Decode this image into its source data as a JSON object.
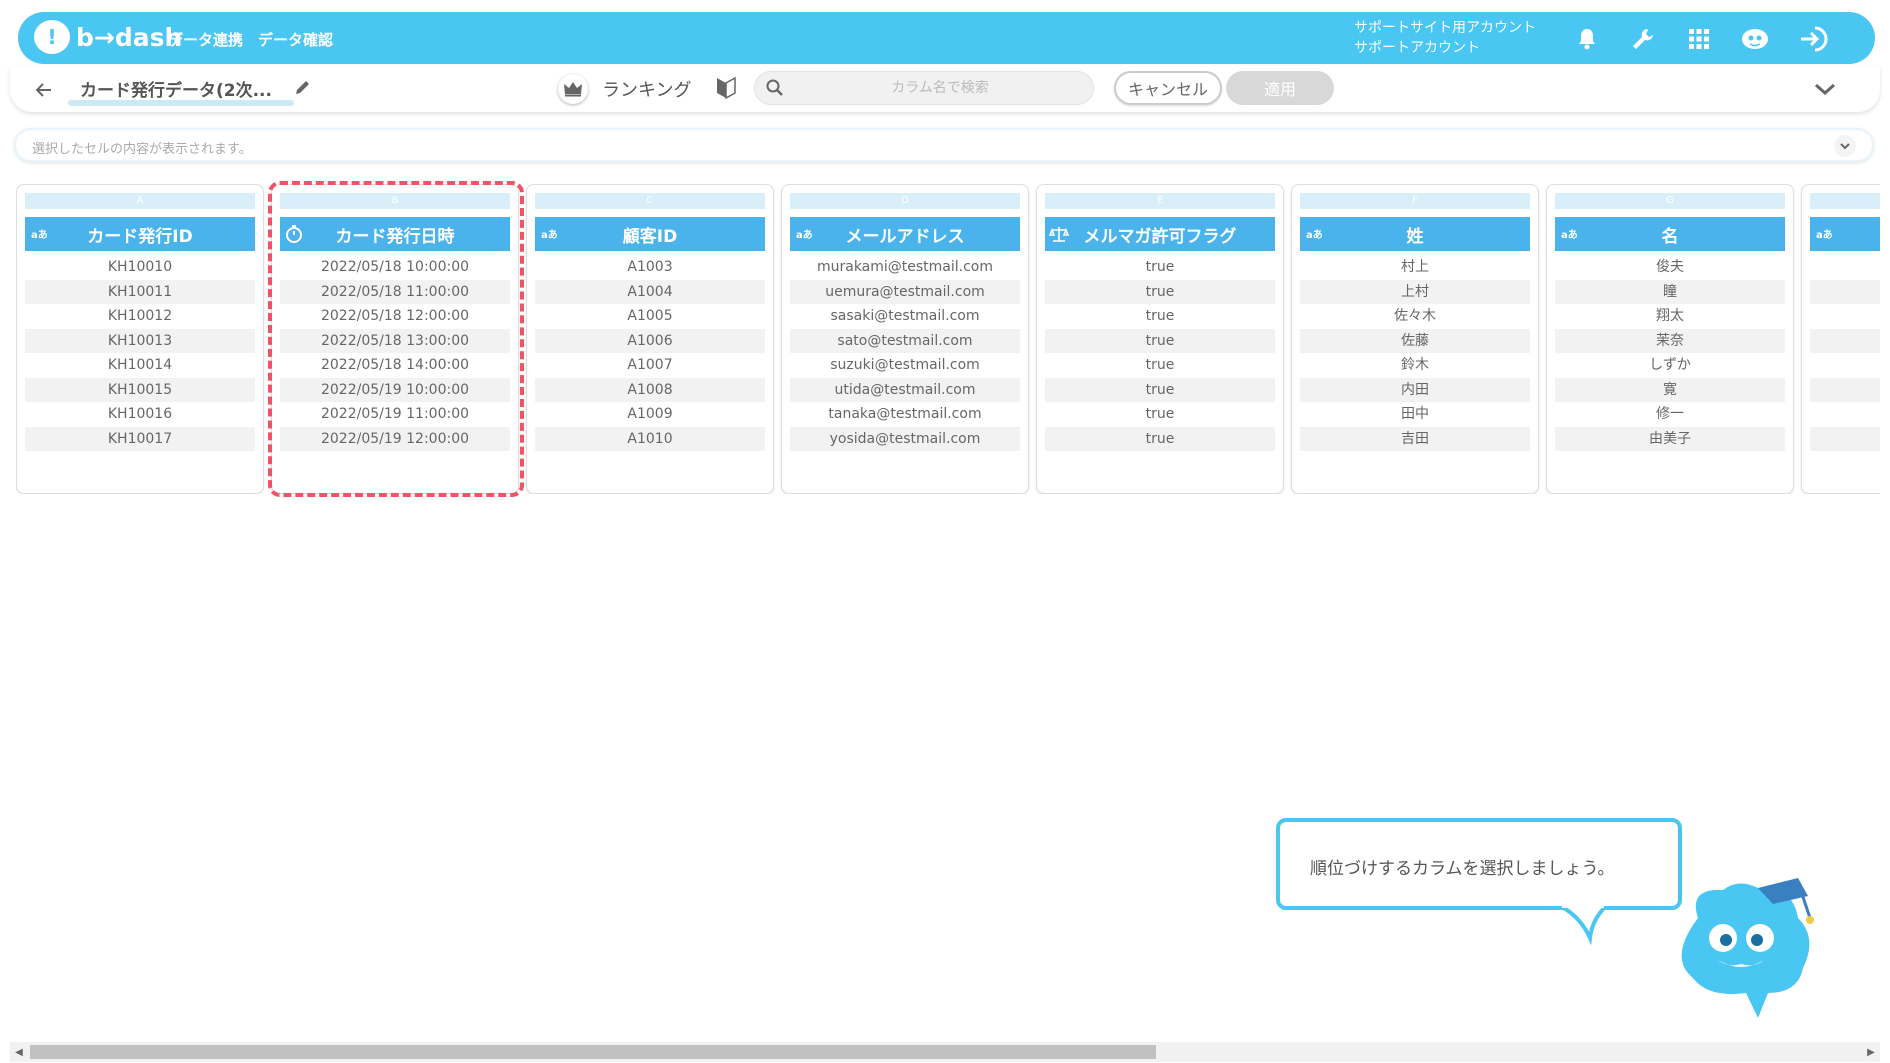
{
  "header": {
    "logo_text": "b→dash",
    "nav": [
      "データ連携",
      "データ確認"
    ],
    "account_line1": "サポートサイト用アカウント",
    "account_line2": "サポートアカウント",
    "icons": [
      "bell-icon",
      "wrench-icon",
      "apps-grid-icon",
      "robot-assistant-icon",
      "logout-icon"
    ]
  },
  "toolbar": {
    "file_title": "カード発行データ(2次...",
    "ranking_label": "ランキング",
    "search_placeholder": "カラム名で検索",
    "cancel_label": "キャンセル",
    "apply_label": "適用"
  },
  "cellbar": {
    "placeholder": "選択したセルの内容が表示されます。"
  },
  "columns": [
    {
      "letter": "A",
      "type": "aあ",
      "name": "カード発行ID",
      "values": [
        "KH10010",
        "KH10011",
        "KH10012",
        "KH10013",
        "KH10014",
        "KH10015",
        "KH10016",
        "KH10017"
      ]
    },
    {
      "letter": "B",
      "type": "timer-icon",
      "name": "カード発行日時",
      "values": [
        "2022/05/18 10:00:00",
        "2022/05/18 11:00:00",
        "2022/05/18 12:00:00",
        "2022/05/18 13:00:00",
        "2022/05/18 14:00:00",
        "2022/05/19 10:00:00",
        "2022/05/19 11:00:00",
        "2022/05/19 12:00:00"
      ]
    },
    {
      "letter": "C",
      "type": "aあ",
      "name": "顧客ID",
      "values": [
        "A1003",
        "A1004",
        "A1005",
        "A1006",
        "A1007",
        "A1008",
        "A1009",
        "A1010"
      ]
    },
    {
      "letter": "D",
      "type": "aあ",
      "name": "メールアドレス",
      "values": [
        "murakami@testmail.com",
        "uemura@testmail.com",
        "sasaki@testmail.com",
        "sato@testmail.com",
        "suzuki@testmail.com",
        "utida@testmail.com",
        "tanaka@testmail.com",
        "yosida@testmail.com"
      ]
    },
    {
      "letter": "E",
      "type": "balance-icon",
      "name": "メルマガ許可フラグ",
      "values": [
        "true",
        "true",
        "true",
        "true",
        "true",
        "true",
        "true",
        "true"
      ]
    },
    {
      "letter": "F",
      "type": "aあ",
      "name": "姓",
      "values": [
        "村上",
        "上村",
        "佐々木",
        "佐藤",
        "鈴木",
        "内田",
        "田中",
        "吉田"
      ]
    },
    {
      "letter": "G",
      "type": "aあ",
      "name": "名",
      "values": [
        "俊夫",
        "瞳",
        "翔太",
        "茉奈",
        "しずか",
        "寛",
        "修一",
        "由美子"
      ]
    },
    {
      "letter": "",
      "type": "aあ",
      "name": "",
      "values": [
        "",
        "",
        "",
        "",
        "",
        "",
        "",
        ""
      ]
    }
  ],
  "tooltip": {
    "text": "順位づけするカラムを選択しましょう。"
  }
}
